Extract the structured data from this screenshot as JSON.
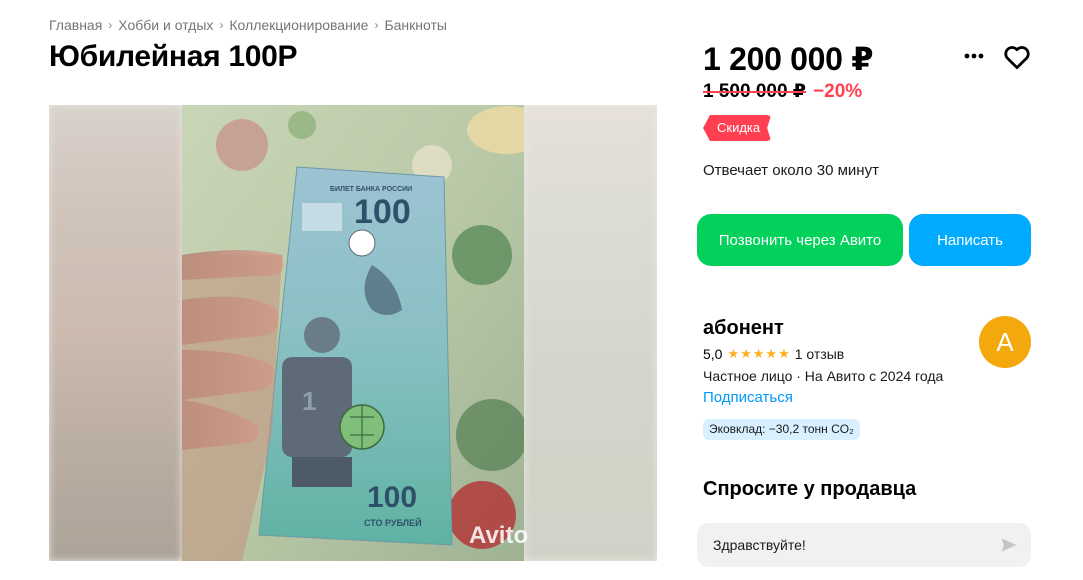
{
  "breadcrumb": [
    "Главная",
    "Хобби и отдых",
    "Коллекционирование",
    "Банкноты"
  ],
  "title": "Юбилейная 100Р",
  "gallery": {
    "watermark": "Avito"
  },
  "price": {
    "current": "1 200 000 ₽",
    "old": "1 500 000 ₽",
    "discount": "−20%"
  },
  "badge": "Скидка",
  "response_time": "Отвечает около 30 минут",
  "actions": {
    "call_label": "Позвонить через Авито",
    "write_label": "Написать"
  },
  "icons": {
    "more": "more-dots-icon",
    "favorite": "heart-icon",
    "send": "send-icon"
  },
  "seller": {
    "name": "абонент",
    "rating": "5,0",
    "reviews": "1 отзыв",
    "info": "Частное лицо · На Авито с 2024 года",
    "subscribe": "Подписаться",
    "eco": "Эковклад: −30,2 тонн CO₂",
    "avatar_letter": "А",
    "avatar_color": "#f3a80c"
  },
  "ask": {
    "title": "Спросите у продавца",
    "message_value": "Здравствуйте!"
  },
  "colors": {
    "green": "#02d15c",
    "blue": "#00aaff",
    "red": "#ff4053",
    "link": "#0099f7"
  }
}
